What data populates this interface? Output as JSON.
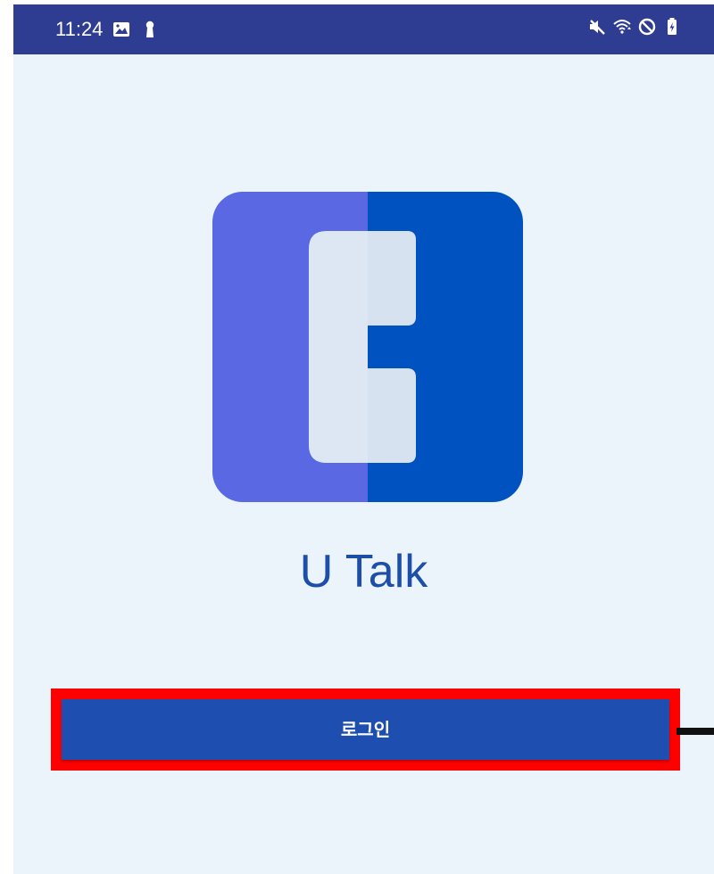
{
  "status_bar": {
    "time": "11:24",
    "left_icons": [
      "image-icon",
      "keyhole-icon"
    ],
    "right_icons": [
      "mute-icon",
      "wifi-icon",
      "do-not-disturb-icon",
      "battery-charging-icon"
    ]
  },
  "app": {
    "title": "U Talk",
    "login_label": "로그인"
  },
  "colors": {
    "status_bar": "#2e3d92",
    "background": "#ebf3fb",
    "logo_left": "#5a68e3",
    "logo_right": "#0052c1",
    "logo_glyph": "#dce7f3",
    "title": "#1e4fa8",
    "button": "#1e4eb0",
    "highlight": "#ff0000"
  }
}
